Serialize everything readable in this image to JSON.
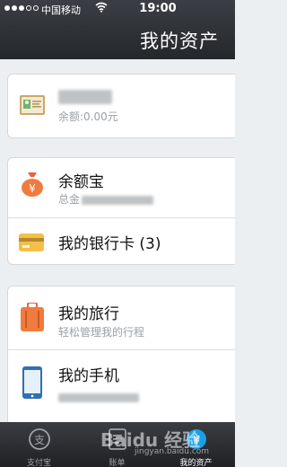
{
  "status_bar": {
    "carrier": "中国移动",
    "time": "19:00"
  },
  "header": {
    "title": "我的资产"
  },
  "account": {
    "balance": "余额:0.00元"
  },
  "yuebao": {
    "title": "余额宝",
    "subtitle_prefix": "总金"
  },
  "bank_card": {
    "title": "我的银行卡 (3)"
  },
  "travel": {
    "title": "我的旅行",
    "subtitle": "轻松管理我的行程"
  },
  "phone": {
    "title": "我的手机"
  },
  "tabs": [
    {
      "label": "支付宝"
    },
    {
      "label": "账单"
    },
    {
      "label": "我的资产"
    }
  ],
  "watermark": {
    "text": "Baidu 经验",
    "sub": "jingyan.baidu.com"
  },
  "colors": {
    "accent_orange": "#f07b3f",
    "card_gold": "#f2c04a",
    "header_dark": "#2e3136"
  }
}
